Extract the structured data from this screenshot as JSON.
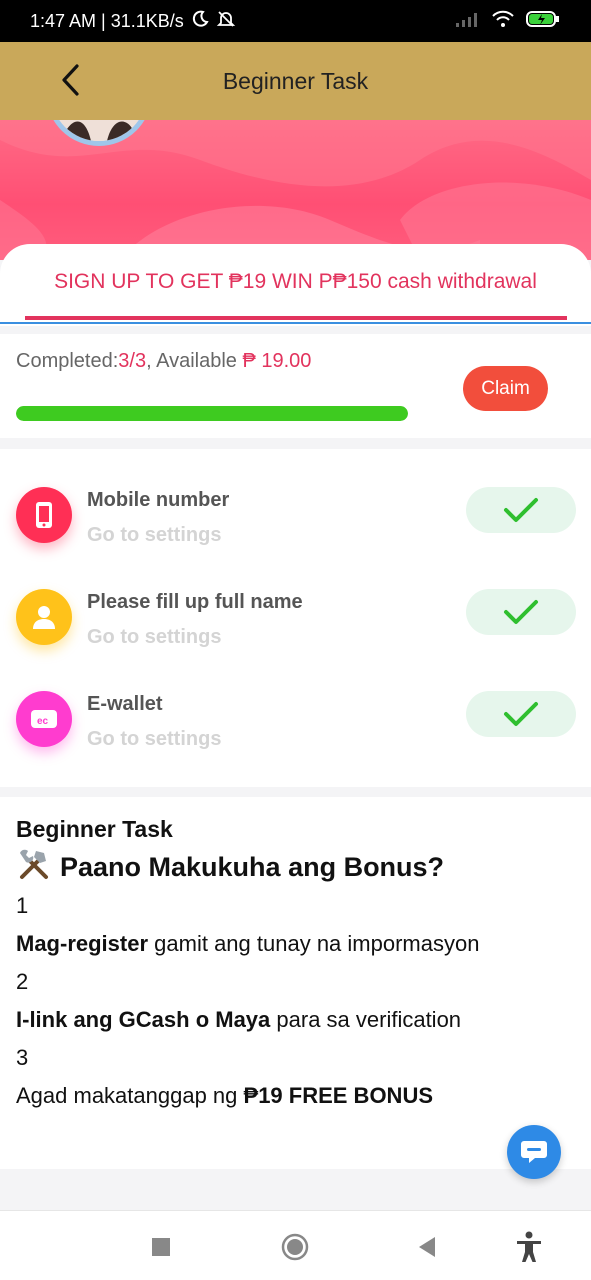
{
  "status_bar": {
    "time_speed": "1:47 AM | 31.1KB/s"
  },
  "header": {
    "title": "Beginner Task"
  },
  "tab": {
    "label": "SIGN UP TO GET ₱19 WIN P₱150 cash withdrawal"
  },
  "progress": {
    "completed_label": "Completed:",
    "completed_value": "3/3",
    "available_label": ", Available ",
    "available_value": "₱ 19.00",
    "percent": 100,
    "claim_label": "Claim"
  },
  "tasks": [
    {
      "title": "Mobile number",
      "subtitle": "Go to settings",
      "icon": "phone-icon",
      "color": "#ff2f55"
    },
    {
      "title": "Please fill up full name",
      "subtitle": "Go to settings",
      "icon": "user-icon",
      "color": "#ffc21a"
    },
    {
      "title": "E-wallet",
      "subtitle": "Go to settings",
      "icon": "wallet-icon",
      "color": "#ff3ccf"
    }
  ],
  "info": {
    "title": "Beginner Task",
    "heading": "Paano Makukuha ang Bonus?",
    "steps": [
      {
        "num": "1",
        "bold": "Mag-register",
        "text": " gamit ang tunay na impormasyon"
      },
      {
        "num": "2",
        "bold": "I-link ang GCash o Maya",
        "text": " para sa verification"
      },
      {
        "num": "3",
        "prefix": "Agad makatanggap ng ",
        "bold": "₱19 FREE BONUS"
      }
    ]
  },
  "colors": {
    "header_bg": "#c9a85a",
    "accent_red": "#e2335d",
    "claim_bg": "#f24e3c",
    "progress_fill": "#3ecb20",
    "check_green": "#2fbf2f"
  }
}
